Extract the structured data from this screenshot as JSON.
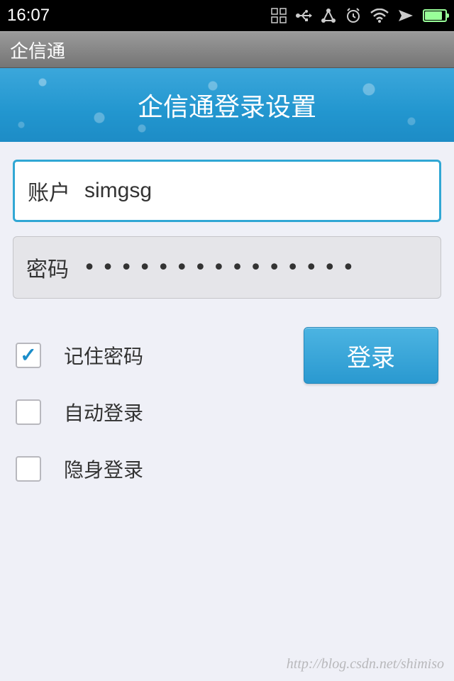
{
  "status_bar": {
    "time": "16:07"
  },
  "title_bar": {
    "app_name": "企信通"
  },
  "banner": {
    "title": "企信通登录设置"
  },
  "form": {
    "account_label": "账户",
    "account_value": "simgsg",
    "password_label": "密码",
    "password_value": "•••••••••••••••"
  },
  "options": {
    "remember_password": {
      "label": "记住密码",
      "checked": true
    },
    "auto_login": {
      "label": "自动登录",
      "checked": false
    },
    "invisible_login": {
      "label": "隐身登录",
      "checked": false
    }
  },
  "login_button": "登录",
  "watermark": "http://blog.csdn.net/shimiso"
}
